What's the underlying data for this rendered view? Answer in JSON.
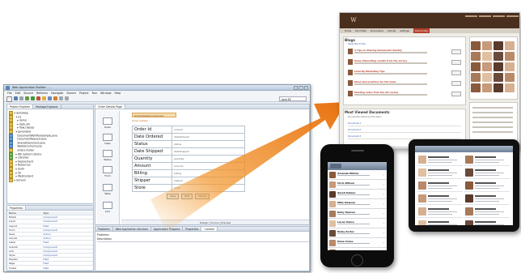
{
  "ide": {
    "title": "Web Application Builder - ...",
    "menu": [
      "File",
      "Edit",
      "Source",
      "Refactor",
      "Navigate",
      "Search",
      "Project",
      "Run",
      "Window",
      "Help"
    ],
    "perspective": "Java EE",
    "package_panel": {
      "tabs": [
        "Project Explorer",
        "Package Explorer"
      ],
      "tree": [
        "▾ demoApp",
        "  ▾ src",
        "    ▸ demo",
        "    ▸ data.util",
        "    ▸ flow.classes",
        "  ▾ generated",
        "    DocumentWorkflowSample.java",
        "    DocumentRequest.java",
        "    SharedDocument.java",
        "    WebDocument.java",
        "    orders.model",
        "  ▸ JRE System Library",
        "  ▸ Libraries",
        "  ▸ Deployment",
        "  ▸ Resources",
        "  ▸ build",
        "  ▸ lib",
        "  ▸ WebContent",
        "▸ Servers"
      ]
    },
    "properties_panel": {
      "tab": "Properties",
      "columns": [
        "Name",
        "Type"
      ],
      "rows": [
        [
          "Model",
          "Component"
        ],
        [
          "Input",
          "Component"
        ],
        [
          "Layout",
          "Field"
        ],
        [
          "Form",
          "Component"
        ],
        [
          "Save",
          "Action"
        ],
        [
          "Cancel",
          "Action"
        ],
        [
          "Label",
          "Field"
        ],
        [
          "Submit",
          "Component"
        ],
        [
          "Link",
          "Component"
        ],
        [
          "Style",
          "Component"
        ],
        [
          "Header",
          "Field"
        ],
        [
          "Page",
          "Field"
        ],
        [
          "Footer",
          "Field"
        ]
      ]
    },
    "editor": {
      "tab": "Order Details Page",
      "palette": [
        "Order",
        "Date",
        "Status",
        "Form",
        "Table",
        "Link"
      ],
      "form_header": "OrderDetailsComponent",
      "form_subtitle": "Order Details",
      "fields": [
        {
          "label": "Order Id",
          "value": "orderId"
        },
        {
          "label": "Date Ordered",
          "value": "dateOrdered"
        },
        {
          "label": "Status",
          "value": "status"
        },
        {
          "label": "Date Shipped",
          "value": "dateShipped"
        },
        {
          "label": "Quantity",
          "value": "quantity"
        },
        {
          "label": "Amount",
          "value": "amount"
        },
        {
          "label": "Billing",
          "value": "billing"
        },
        {
          "label": "Shipper",
          "value": "shipper"
        },
        {
          "label": "Store",
          "value": "store"
        }
      ],
      "buttons": [
        "Save",
        "Edit",
        "Cancel"
      ],
      "footer": "Design | Source | Preview"
    },
    "console": {
      "tabs": [
        "Problems",
        "Web Application Services",
        "Application Progress",
        "Properties",
        "Console"
      ],
      "line1": "Problems",
      "line2": "Description"
    }
  },
  "webpage": {
    "logo": "W",
    "nav": [
      "Home",
      "My Profile",
      "Documents",
      "Activity",
      "Settings",
      "Community"
    ],
    "nav_active_index": 5,
    "blogs_title": "Blogs",
    "blogs_meta": "Subscribe to this",
    "blog_entries": [
      "3 Tips on Sharing Documents Quickly",
      "Some interesting results from the survey",
      "Lead-Up Marketing Tips",
      "Ideas and practices for the team",
      "Meeting notes from the Q3 review"
    ],
    "docs_title": "Most Viewed Documents",
    "docs_sub": "Documents shared by this team",
    "docs": [
      "Document-1",
      "Document-2",
      "Document-3"
    ],
    "colors": {
      "header": "#4a2e1e",
      "accent": "#b3412b"
    }
  },
  "iphone_contacts": [
    "Amanda Mishra",
    "Chris Wilson",
    "Sarah Palmer",
    "Mike Dawson",
    "Kelly Hansen",
    "Lucas Vance",
    "Emily Porter",
    "Dana Crane",
    "Greg Foster"
  ],
  "icons": {
    "gear": "gear-icon",
    "logo": "logo-icon",
    "arrow": "arrow-graphic"
  }
}
